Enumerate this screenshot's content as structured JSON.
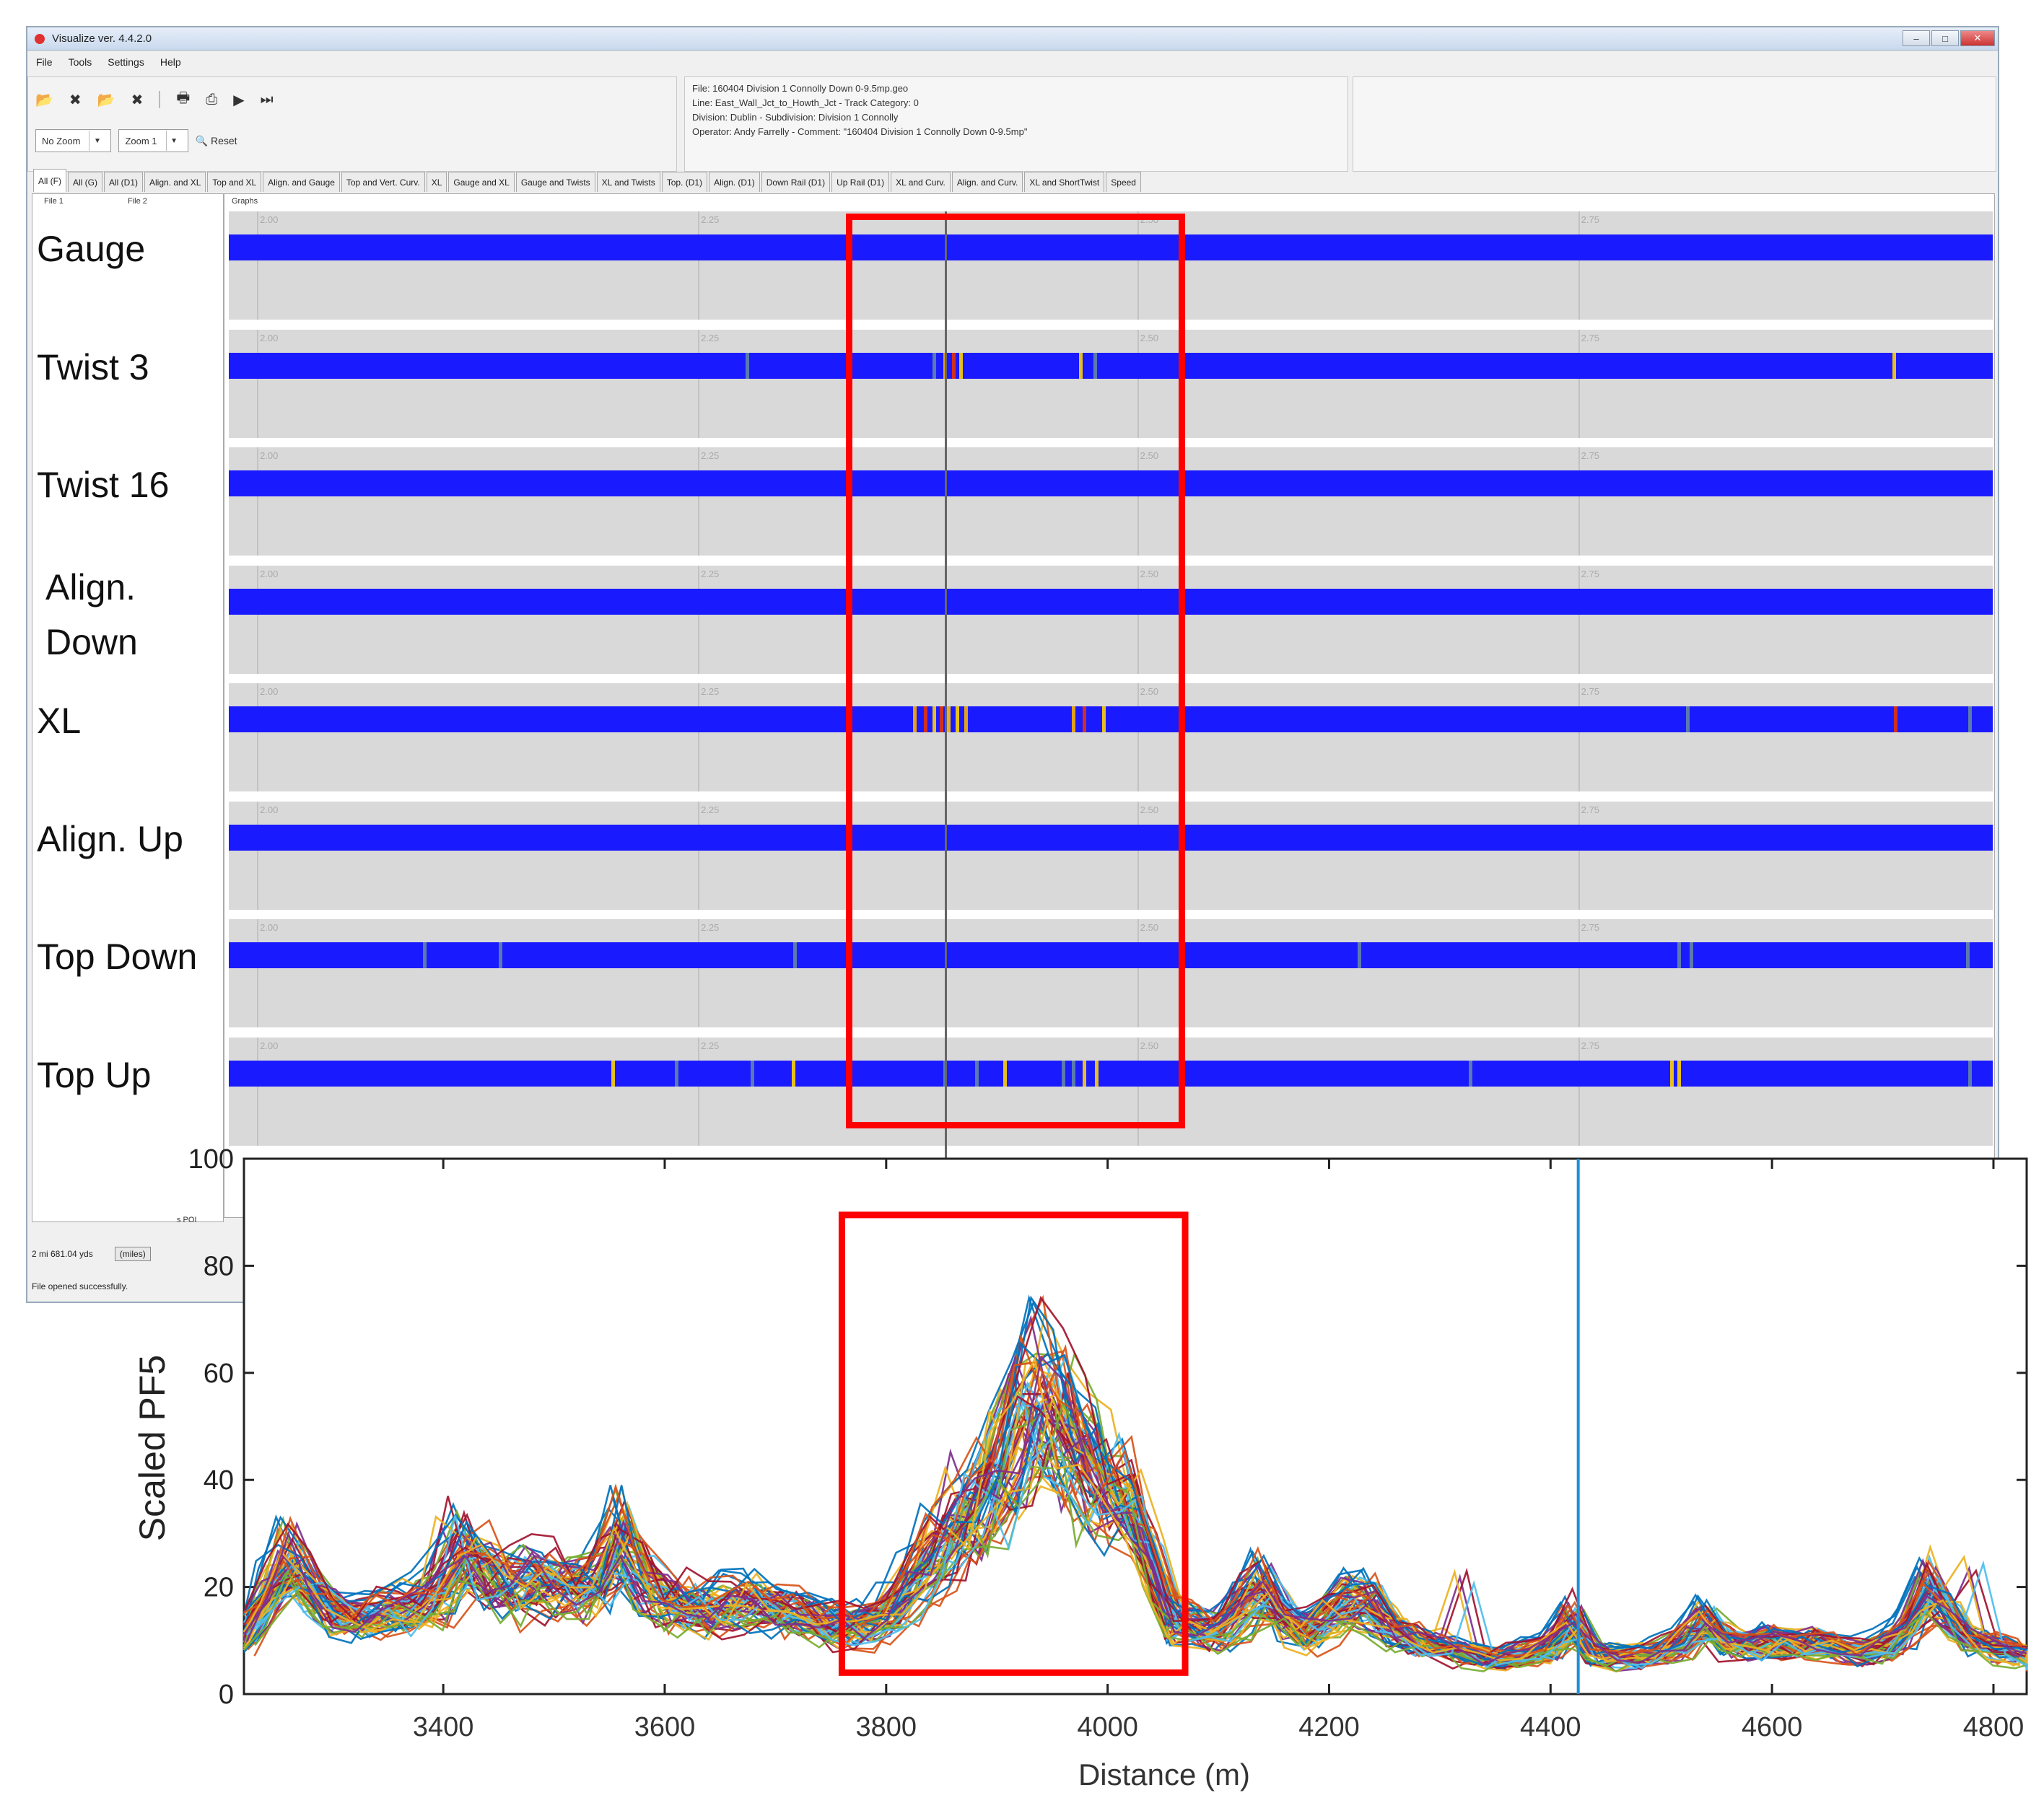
{
  "window": {
    "title": "Visualize ver. 4.4.2.0",
    "menu": [
      "File",
      "Tools",
      "Settings",
      "Help"
    ],
    "zoom_value": "No Zoom",
    "zoom_level": "Zoom 1",
    "reset_label": "Reset",
    "info_lines": [
      "File: 160404 Division 1 Connolly Down 0-9.5mp.geo",
      "Line: East_Wall_Jct_to_Howth_Jct - Track Category: 0",
      "Division: Dublin - Subdivision: Division 1 Connolly",
      "Operator: Andy Farrelly - Comment: \"160404 Division 1 Connolly Down 0-9.5mp\""
    ],
    "tabs": [
      "All (F)",
      "All (G)",
      "All (D1)",
      "Align. and XL",
      "Top and XL",
      "Align. and Gauge",
      "Top and Vert. Curv.",
      "XL",
      "Gauge and XL",
      "Gauge and Twists",
      "XL and Twists",
      "Top. (D1)",
      "Align. (D1)",
      "Down Rail (D1)",
      "Up Rail (D1)",
      "XL and Curv.",
      "Align. and Curv.",
      "XL and ShortTwist",
      "Speed"
    ],
    "file1_label": "File 1",
    "file2_label": "File 2",
    "graphs_label": "Graphs",
    "poi_label": "s POI",
    "distance_value": "2 mi 681.04 yds",
    "miles_button": "(miles)",
    "status_text": "File opened successfully."
  },
  "tracks": [
    {
      "label": "Gauge",
      "defects": []
    },
    {
      "label": "Twist 3",
      "defects": [
        {
          "p": 0.293,
          "c": "#5a7ab0"
        },
        {
          "p": 0.399,
          "c": "#5a7ab0"
        },
        {
          "p": 0.405,
          "c": "#e0a020"
        },
        {
          "p": 0.41,
          "c": "#d03020"
        },
        {
          "p": 0.414,
          "c": "#e6c020"
        },
        {
          "p": 0.482,
          "c": "#e6c020"
        },
        {
          "p": 0.49,
          "c": "#5a7ab0"
        },
        {
          "p": 0.943,
          "c": "#e6c020"
        }
      ]
    },
    {
      "label": "Twist 16",
      "defects": []
    },
    {
      "label": "Align.\nDown",
      "defects": []
    },
    {
      "label": "XL",
      "defects": [
        {
          "p": 0.388,
          "c": "#e6a020"
        },
        {
          "p": 0.394,
          "c": "#d03020"
        },
        {
          "p": 0.399,
          "c": "#e6c020"
        },
        {
          "p": 0.403,
          "c": "#d03020"
        },
        {
          "p": 0.407,
          "c": "#e8b020"
        },
        {
          "p": 0.412,
          "c": "#e6c020"
        },
        {
          "p": 0.417,
          "c": "#e0a020"
        },
        {
          "p": 0.478,
          "c": "#e0a020"
        },
        {
          "p": 0.484,
          "c": "#d03020"
        },
        {
          "p": 0.495,
          "c": "#e6c020"
        },
        {
          "p": 0.826,
          "c": "#5a7ab0"
        },
        {
          "p": 0.944,
          "c": "#d03020"
        },
        {
          "p": 0.986,
          "c": "#5a7ab0"
        }
      ]
    },
    {
      "label": "Align. Up",
      "defects": []
    },
    {
      "label": "Top Down",
      "defects": [
        {
          "p": 0.11,
          "c": "#5a7ab0"
        },
        {
          "p": 0.153,
          "c": "#5a7ab0"
        },
        {
          "p": 0.32,
          "c": "#5a7ab0"
        },
        {
          "p": 0.64,
          "c": "#5a7ab0"
        },
        {
          "p": 0.821,
          "c": "#5a7ab0"
        },
        {
          "p": 0.828,
          "c": "#5a7ab0"
        },
        {
          "p": 0.985,
          "c": "#5a7ab0"
        }
      ]
    },
    {
      "label": "Top Up",
      "defects": [
        {
          "p": 0.217,
          "c": "#e6c020"
        },
        {
          "p": 0.253,
          "c": "#5a7ab0"
        },
        {
          "p": 0.296,
          "c": "#5a7ab0"
        },
        {
          "p": 0.319,
          "c": "#e6c020"
        },
        {
          "p": 0.405,
          "c": "#5a7ab0"
        },
        {
          "p": 0.423,
          "c": "#5a7ab0"
        },
        {
          "p": 0.439,
          "c": "#e6c020"
        },
        {
          "p": 0.472,
          "c": "#5a7ab0"
        },
        {
          "p": 0.478,
          "c": "#5a7ab0"
        },
        {
          "p": 0.484,
          "c": "#e6c020"
        },
        {
          "p": 0.491,
          "c": "#e6c020"
        },
        {
          "p": 0.703,
          "c": "#5a7ab0"
        },
        {
          "p": 0.817,
          "c": "#e6c020"
        },
        {
          "p": 0.821,
          "c": "#e6c020"
        },
        {
          "p": 0.986,
          "c": "#5a7ab0"
        }
      ]
    }
  ],
  "strip_ticks": [
    {
      "p": 0.016,
      "label": "2.00"
    },
    {
      "p": 0.266,
      "label": "2.25"
    },
    {
      "p": 0.515,
      "label": "2.50"
    },
    {
      "p": 0.765,
      "label": "2.75"
    }
  ],
  "strip_cursor_p": 0.406,
  "colors": {
    "track_bar": "#1a1aff",
    "highlight_box": "#ff0000",
    "strip_bg": "#d9d9d9"
  },
  "chart_data": {
    "type": "line",
    "xlabel": "Distance (m)",
    "ylabel": "Scaled PF5",
    "xlim": [
      3220,
      4830
    ],
    "ylim": [
      0,
      100
    ],
    "xticks": [
      3400,
      3600,
      3800,
      4000,
      4200,
      4400,
      4600,
      4800
    ],
    "yticks": [
      0,
      20,
      40,
      60,
      80,
      100
    ],
    "vertical_line_x": 4425,
    "highlight_x_range": [
      3760,
      4070
    ],
    "profile": {
      "x": [
        3220,
        3240,
        3260,
        3280,
        3300,
        3320,
        3340,
        3360,
        3380,
        3400,
        3420,
        3440,
        3460,
        3480,
        3500,
        3520,
        3540,
        3560,
        3580,
        3600,
        3620,
        3640,
        3660,
        3680,
        3700,
        3720,
        3740,
        3760,
        3780,
        3800,
        3820,
        3840,
        3860,
        3880,
        3900,
        3920,
        3940,
        3960,
        3980,
        4000,
        4020,
        4040,
        4060,
        4080,
        4100,
        4120,
        4140,
        4160,
        4180,
        4200,
        4220,
        4240,
        4260,
        4280,
        4300,
        4320,
        4340,
        4360,
        4380,
        4400,
        4420,
        4440,
        4460,
        4480,
        4500,
        4520,
        4540,
        4560,
        4580,
        4600,
        4620,
        4640,
        4660,
        4680,
        4700,
        4720,
        4740,
        4760,
        4780,
        4800,
        4820,
        4830
      ],
      "y": [
        12,
        18,
        26,
        20,
        16,
        14,
        15,
        16,
        17,
        20,
        27,
        24,
        20,
        22,
        21,
        20,
        22,
        30,
        22,
        18,
        17,
        16,
        17,
        18,
        16,
        15,
        14,
        13,
        13,
        15,
        20,
        26,
        30,
        35,
        42,
        52,
        56,
        52,
        45,
        40,
        36,
        25,
        14,
        13,
        12,
        16,
        20,
        14,
        12,
        15,
        18,
        17,
        12,
        10,
        9,
        8,
        7,
        7,
        8,
        9,
        14,
        8,
        7,
        7,
        8,
        10,
        14,
        10,
        9,
        10,
        9,
        10,
        9,
        8,
        9,
        12,
        20,
        16,
        10,
        9,
        8,
        7
      ],
      "num_overlaid_runs": 60
    }
  }
}
